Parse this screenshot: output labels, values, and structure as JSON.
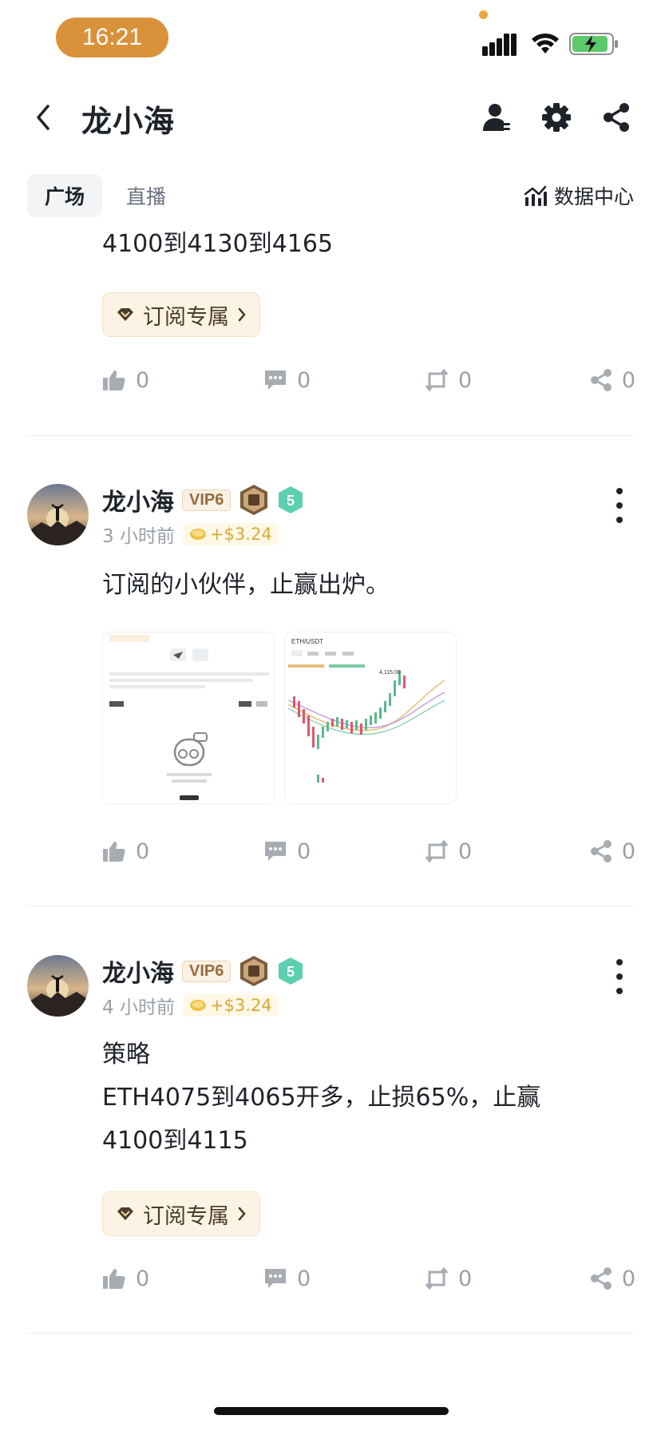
{
  "status_bar": {
    "time": "16:21"
  },
  "header": {
    "title": "龙小海"
  },
  "tabs": [
    {
      "label": "广场"
    },
    {
      "label": "直播"
    }
  ],
  "data_center": {
    "label": "数据中心"
  },
  "post_partial": {
    "text": "4100到4130到4165",
    "subscribe_label": "订阅专属",
    "likes": "0",
    "comments": "0",
    "reposts": "0",
    "shares": "0"
  },
  "posts": [
    {
      "author": "龙小海",
      "vip": "VIP6",
      "level": "5",
      "time": "3 小时前",
      "tip": "+$3.24",
      "text": "订阅的小伙伴，止赢出炉。",
      "thumb_chart_pair": "ETH/USDT",
      "thumb_chart_price": "4,115.00",
      "likes": "0",
      "comments": "0",
      "reposts": "0",
      "shares": "0"
    },
    {
      "author": "龙小海",
      "vip": "VIP6",
      "level": "5",
      "time": "4 小时前",
      "tip": "+$3.24",
      "lines": [
        "策略",
        "ETH4075到4065开多，止损65%，止赢",
        "4100到4115"
      ],
      "subscribe_label": "订阅专属",
      "likes": "0",
      "comments": "0",
      "reposts": "0",
      "shares": "0"
    }
  ],
  "colors": {
    "accent": "#d9913a",
    "subscribe_bg": "#fdf3e4",
    "level_badge": "#5ccfb0",
    "candle_up": "#5bb98c",
    "candle_down": "#e0566b"
  }
}
